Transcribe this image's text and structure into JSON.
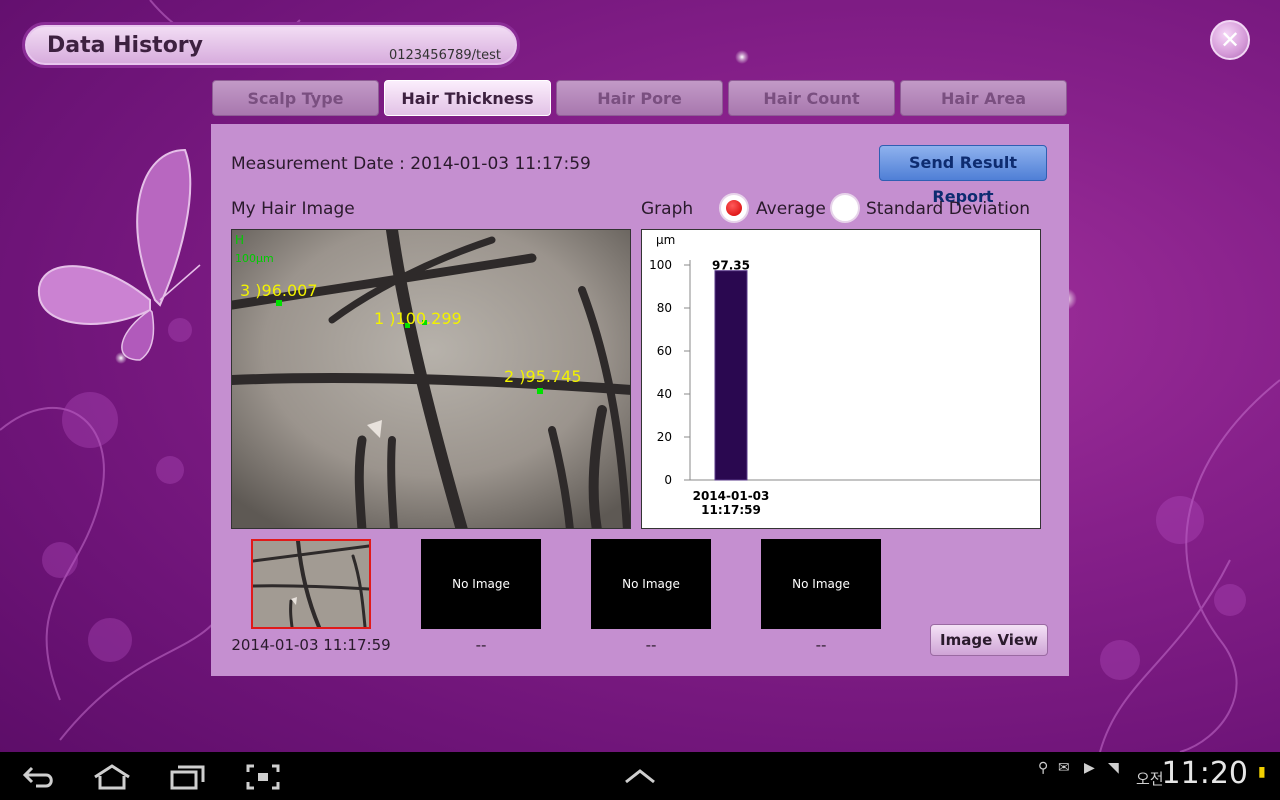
{
  "header": {
    "title": "Data History",
    "user_id": "0123456789/test"
  },
  "close_icon": "close-icon",
  "tabs": [
    {
      "label": "Scalp Type",
      "active": false
    },
    {
      "label": "Hair Thickness",
      "active": true
    },
    {
      "label": "Hair Pore",
      "active": false
    },
    {
      "label": "Hair Count",
      "active": false
    },
    {
      "label": "Hair Area",
      "active": false
    }
  ],
  "panel": {
    "measurement_date": "Measurement Date : 2014-01-03 11:17:59",
    "send_button": "Send Result Report",
    "image_label": "My Hair Image",
    "graph_label": "Graph",
    "radio_average": "Average",
    "radio_std": "Standard Deviation",
    "selected_mode": "Average",
    "image_annotations": [
      {
        "text": "H"
      },
      {
        "text": "100μm"
      },
      {
        "text": "3 )96.007"
      },
      {
        "text": "1 )100.299"
      },
      {
        "text": "2 )95.745"
      }
    ]
  },
  "chart_data": {
    "type": "bar",
    "categories": [
      "2014-01-03\n11:17:59"
    ],
    "category_lines": [
      "2014-01-03",
      "11:17:59"
    ],
    "values": [
      97.35
    ],
    "value_labels": [
      "97.35"
    ],
    "ylabel": "μm",
    "ylim": [
      0,
      100
    ],
    "yticks": [
      "100",
      "80",
      "60",
      "40",
      "20",
      "0"
    ],
    "bar_color": "#2a0850"
  },
  "thumbnails": [
    {
      "label": "",
      "date": "2014-01-03 11:17:59",
      "selected": true
    },
    {
      "label": "No Image",
      "date": "--",
      "selected": false
    },
    {
      "label": "No Image",
      "date": "--",
      "selected": false
    },
    {
      "label": "No Image",
      "date": "--",
      "selected": false
    }
  ],
  "image_view_button": "Image View",
  "statusbar": {
    "ampm": "오전",
    "time": "11:20"
  }
}
